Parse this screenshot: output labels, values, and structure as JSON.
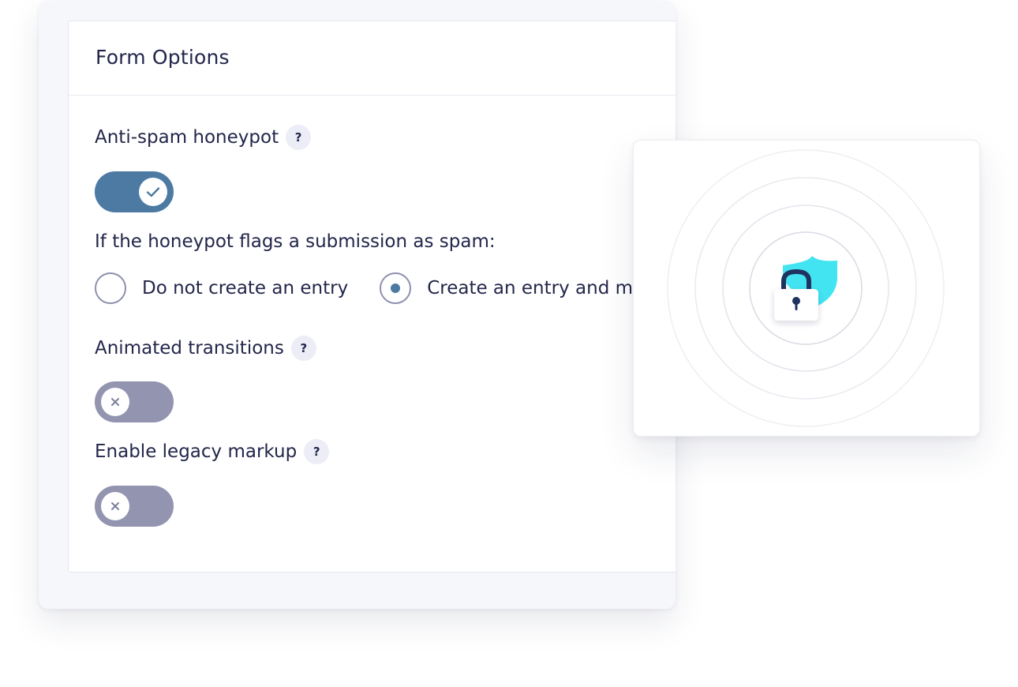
{
  "form_options": {
    "title": "Form Options",
    "honeypot": {
      "label": "Anti-spam honeypot",
      "help": "?",
      "enabled": true
    },
    "spam_action": {
      "question": "If the honeypot flags a submission as spam:",
      "options": [
        {
          "label": "Do not create an entry",
          "selected": false
        },
        {
          "label": "Create an entry and m",
          "selected": true
        }
      ]
    },
    "animated_transitions": {
      "label": "Animated transitions",
      "help": "?",
      "enabled": false
    },
    "legacy_markup": {
      "label": "Enable legacy markup",
      "help": "?",
      "enabled": false
    }
  },
  "security_illustration": {
    "icons": [
      "shield-icon",
      "lock-icon"
    ],
    "colors": {
      "shield": "#43e4f2",
      "lock_shackle": "#1f3360",
      "lock_body": "#ffffff",
      "rings": "#e4e5ec"
    }
  },
  "colors": {
    "toggle_on": "#4c7aa3",
    "toggle_off": "#9294b0",
    "text": "#23264a",
    "help_bg": "#ecedf7"
  }
}
